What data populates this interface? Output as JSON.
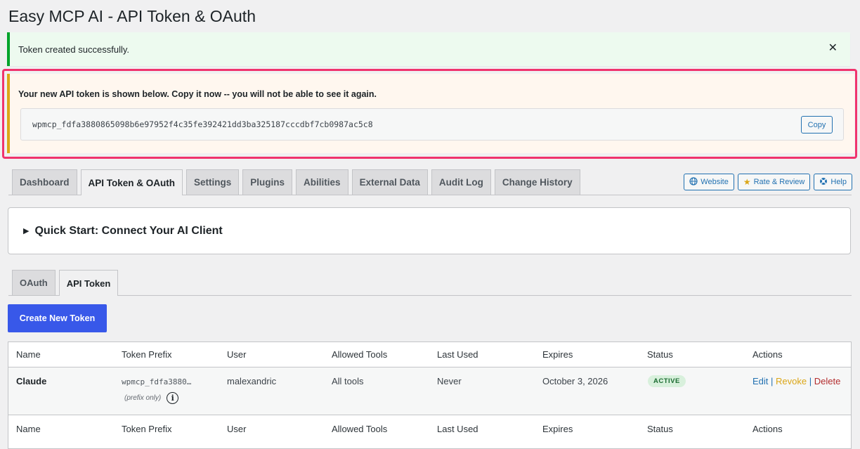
{
  "page": {
    "title": "Easy MCP AI - API Token & OAuth"
  },
  "notices": {
    "success": "Token created successfully.",
    "dismiss": "✕",
    "token_warning": "Your new API token is shown below. Copy it now -- you will not be able to see it again.",
    "token_value": "wpmcp_fdfa3880865098b6e97952f4c35fe392421dd3ba325187cccdbf7cb0987ac5c8",
    "copy_label": "Copy"
  },
  "nav": {
    "tabs": [
      {
        "label": "Dashboard"
      },
      {
        "label": "API Token & OAuth"
      },
      {
        "label": "Settings"
      },
      {
        "label": "Plugins"
      },
      {
        "label": "Abilities"
      },
      {
        "label": "External Data"
      },
      {
        "label": "Audit Log"
      },
      {
        "label": "Change History"
      }
    ],
    "active": "API Token & OAuth",
    "links": [
      {
        "label": "Website",
        "icon": "globe-icon"
      },
      {
        "label": "Rate & Review",
        "icon": "star-icon"
      },
      {
        "label": "Help",
        "icon": "lifebuoy-icon"
      }
    ]
  },
  "quick_start": {
    "label": "Quick Start: Connect Your AI Client"
  },
  "sub_tabs": {
    "tabs": [
      {
        "label": "OAuth"
      },
      {
        "label": "API Token"
      }
    ],
    "active": "API Token"
  },
  "create_button": "Create New Token",
  "table": {
    "columns": [
      "Name",
      "Token Prefix",
      "User",
      "Allowed Tools",
      "Last Used",
      "Expires",
      "Status",
      "Actions"
    ],
    "rows": [
      {
        "name": "Claude",
        "prefix": "wpmcp_fdfa3880…",
        "prefix_note": "(prefix only)",
        "user": "malexandric",
        "allowed_tools": "All tools",
        "last_used": "Never",
        "expires": "October 3, 2026",
        "status": "ACTIVE",
        "actions": {
          "edit": "Edit",
          "revoke": "Revoke",
          "delete": "Delete",
          "separator": "|"
        }
      }
    ]
  },
  "colors": {
    "accent": "#3858e9",
    "success": "#00a32a",
    "warning": "#dba617",
    "highlight": "#f0336d",
    "link": "#2271b1",
    "danger": "#b32d2e"
  }
}
